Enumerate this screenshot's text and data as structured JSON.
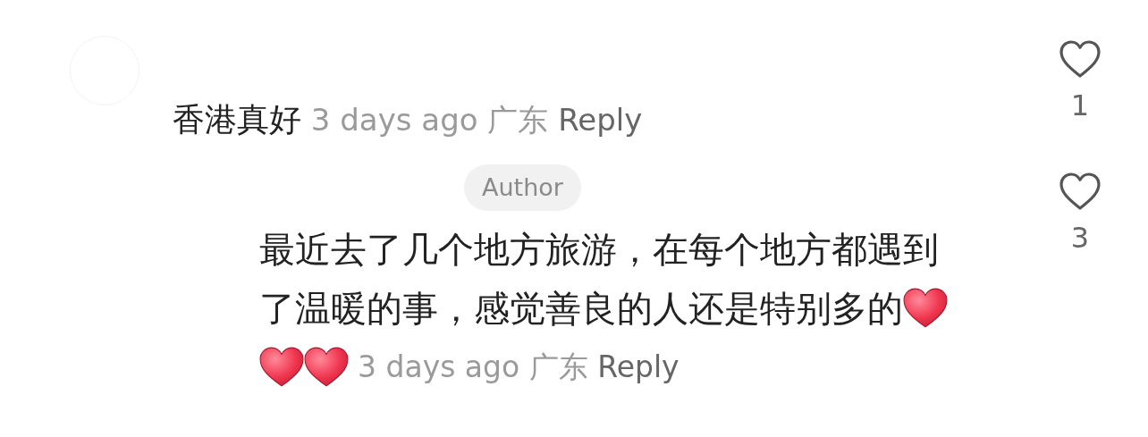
{
  "comments": [
    {
      "name": "香港真好",
      "time": "3 days ago",
      "location": "广东",
      "reply": "Reply",
      "likes": "1",
      "liked": false
    },
    {
      "badge": "Author",
      "lines": [
        {
          "text": "最近去了几个地方旅游，在每个地方都遇到"
        },
        {
          "text": "了温暖的事，感觉善良的人还是特别多的",
          "emojis": [
            {
              "kind": "heart"
            }
          ]
        }
      ],
      "meta_emojis": [
        {
          "kind": "heart"
        },
        {
          "kind": "heart"
        }
      ],
      "time": "3 days ago",
      "location": "广东",
      "reply": "Reply",
      "likes": "3",
      "liked": false
    }
  ]
}
